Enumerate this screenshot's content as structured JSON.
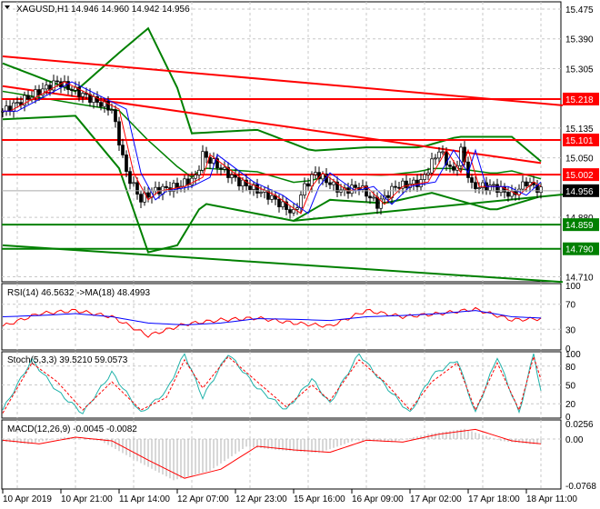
{
  "header": {
    "symbol": "XAGUSD,H1",
    "ohlc": "14.946 14.960 14.942 14.956"
  },
  "colors": {
    "up": "#000000",
    "red": "#ff0000",
    "green": "#008000",
    "blue": "#0000ff",
    "teal": "#20b2aa"
  },
  "chart_data": [
    {
      "type": "line",
      "title": "XAGUSD,H1",
      "ylim": [
        14.71,
        15.475
      ],
      "yticks": [
        "15.475",
        "15.390",
        "15.305",
        "15.135",
        "15.050",
        "14.880",
        "14.710"
      ],
      "xticks": [
        "10 Apr 2019",
        "10 Apr 21:00",
        "11 Apr 14:00",
        "12 Apr 07:00",
        "12 Apr 23:00",
        "15 Apr 16:00",
        "16 Apr 09:00",
        "17 Apr 02:00",
        "17 Apr 18:00",
        "18 Apr 11:00"
      ],
      "price_bars": [
        1,
        8,
        15,
        25,
        30,
        34,
        38,
        41,
        48,
        53,
        55,
        60,
        65,
        73,
        80,
        83,
        86,
        93,
        98,
        103,
        108,
        115,
        120,
        124,
        126,
        129,
        135,
        140,
        144,
        148
      ],
      "price": [
        15.189,
        15.228,
        15.267,
        15.215,
        15.189,
        15.007,
        14.93,
        14.955,
        14.968,
        14.994,
        15.059,
        15.02,
        14.981,
        14.943,
        14.891,
        14.968,
        15.007,
        14.955,
        14.968,
        14.917,
        14.968,
        14.981,
        15.072,
        15.007,
        15.072,
        14.968,
        14.968,
        14.943,
        14.981,
        14.956
      ],
      "levels": [
        {
          "label": "15.218",
          "value": 15.218,
          "color": "red"
        },
        {
          "label": "15.101",
          "value": 15.101,
          "color": "red"
        },
        {
          "label": "15.002",
          "value": 15.002,
          "color": "red"
        },
        {
          "label": "14.859",
          "value": 14.859,
          "color": "green"
        },
        {
          "label": "14.790",
          "value": 14.79,
          "color": "green"
        }
      ],
      "current": {
        "label": "14.956",
        "value": 14.956
      },
      "trendlines": [
        {
          "color": "red",
          "from": [
            0,
            15.34
          ],
          "to": [
            154,
            15.2
          ]
        },
        {
          "color": "red",
          "from": [
            0,
            15.255
          ],
          "to": [
            148,
            15.035
          ]
        },
        {
          "color": "green",
          "from": [
            0,
            14.8
          ],
          "to": [
            154,
            14.695
          ]
        },
        {
          "color": "green",
          "from": [
            80,
            14.87
          ],
          "to": [
            154,
            14.945
          ]
        }
      ],
      "bb_upper": [
        [
          0,
          15.32
        ],
        [
          20,
          15.24
        ],
        [
          32,
          15.35
        ],
        [
          40,
          15.42
        ],
        [
          48,
          15.25
        ],
        [
          52,
          15.12
        ],
        [
          70,
          15.13
        ],
        [
          85,
          15.07
        ],
        [
          100,
          15.08
        ],
        [
          115,
          15.08
        ],
        [
          125,
          15.11
        ],
        [
          140,
          15.11
        ],
        [
          148,
          15.04
        ]
      ],
      "bb_lower": [
        [
          0,
          15.16
        ],
        [
          20,
          15.17
        ],
        [
          32,
          15.02
        ],
        [
          40,
          14.78
        ],
        [
          48,
          14.8
        ],
        [
          55,
          14.92
        ],
        [
          70,
          14.89
        ],
        [
          80,
          14.87
        ],
        [
          90,
          14.93
        ],
        [
          105,
          14.92
        ],
        [
          118,
          14.95
        ],
        [
          135,
          14.9
        ],
        [
          148,
          14.94
        ]
      ]
    },
    {
      "type": "line",
      "title": "RSI(14) 46.5632  ->MA(18) 48.4993",
      "ylim": [
        0,
        100
      ],
      "yticks": [
        "100",
        "70",
        "30",
        "0"
      ],
      "bars": [
        0,
        10,
        20,
        30,
        40,
        50,
        60,
        70,
        80,
        90,
        100,
        110,
        120,
        130,
        140,
        148
      ],
      "rsi": [
        35,
        55,
        60,
        50,
        20,
        38,
        45,
        48,
        40,
        35,
        60,
        50,
        55,
        62,
        45,
        47
      ],
      "ma": [
        50,
        52,
        55,
        50,
        40,
        37,
        40,
        47,
        46,
        44,
        50,
        52,
        55,
        60,
        50,
        48
      ]
    },
    {
      "type": "line",
      "title": "Stoch(5,3,3) 39.5210 59.0573",
      "ylim": [
        0,
        100
      ],
      "yticks": [
        "100",
        "80",
        "50",
        "20",
        "0"
      ],
      "bars": [
        0,
        8,
        15,
        22,
        30,
        38,
        45,
        50,
        55,
        62,
        70,
        78,
        85,
        90,
        98,
        105,
        112,
        118,
        125,
        130,
        136,
        142,
        146,
        148
      ],
      "main": [
        10,
        90,
        40,
        5,
        70,
        5,
        40,
        100,
        30,
        100,
        45,
        10,
        60,
        20,
        100,
        50,
        5,
        65,
        90,
        5,
        95,
        5,
        100,
        40
      ],
      "signal": [
        5,
        85,
        55,
        10,
        55,
        10,
        30,
        90,
        45,
        95,
        55,
        15,
        50,
        25,
        90,
        55,
        10,
        55,
        85,
        10,
        85,
        10,
        95,
        59
      ]
    },
    {
      "type": "bar",
      "title": "MACD(12,26,9) -0.0045 -0.0082",
      "ylim": [
        -0.0768,
        0.0256
      ],
      "yticks": [
        "0.0256",
        "0.00",
        "-0.0768"
      ],
      "bars": [
        0,
        10,
        20,
        30,
        40,
        50,
        60,
        70,
        80,
        90,
        100,
        110,
        120,
        130,
        140,
        148
      ],
      "signal": [
        -0.002,
        -0.008,
        0.003,
        -0.003,
        -0.035,
        -0.065,
        -0.05,
        -0.012,
        -0.018,
        -0.022,
        -0.002,
        -0.005,
        0.008,
        0.016,
        -0.003,
        -0.008
      ]
    }
  ]
}
